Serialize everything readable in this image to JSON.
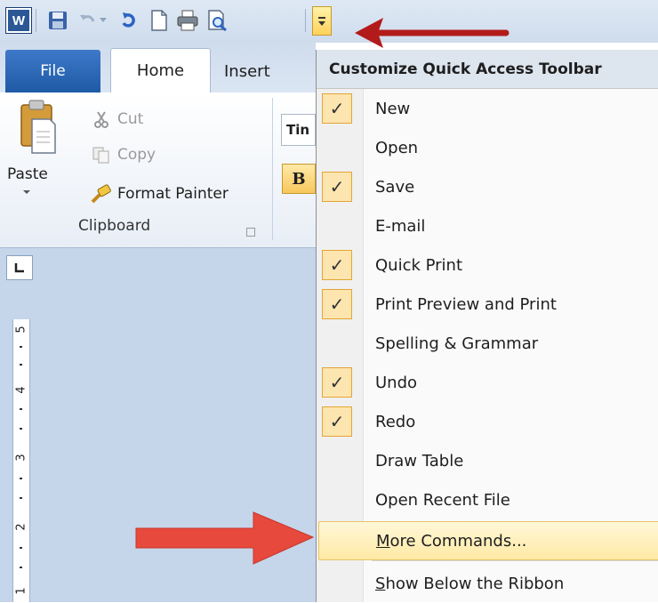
{
  "app": {
    "logo_letter": "W"
  },
  "ribbon": {
    "tabs": {
      "file": "File",
      "home": "Home",
      "insert": "Insert"
    },
    "clipboard": {
      "paste": "Paste",
      "cut": "Cut",
      "copy": "Copy",
      "format_painter": "Format Painter",
      "group_label": "Clipboard"
    },
    "font_box": "Tin",
    "bold": "B"
  },
  "ruler": {
    "numbers": [
      "5",
      "4",
      "3",
      "2",
      "1"
    ]
  },
  "menu": {
    "header": "Customize Quick Access Toolbar",
    "items": [
      {
        "label": "New",
        "checked": true
      },
      {
        "label": "Open",
        "checked": false
      },
      {
        "label": "Save",
        "checked": true
      },
      {
        "label": "E-mail",
        "checked": false
      },
      {
        "label": "Quick Print",
        "checked": true
      },
      {
        "label": "Print Preview and Print",
        "checked": true
      },
      {
        "label": "Spelling & Grammar",
        "checked": false
      },
      {
        "label": "Undo",
        "checked": true
      },
      {
        "label": "Redo",
        "checked": true
      },
      {
        "label": "Draw Table",
        "checked": false
      },
      {
        "label": "Open Recent File",
        "checked": false
      }
    ],
    "more_commands": {
      "first": "M",
      "rest": "ore Commands..."
    },
    "show_below": {
      "first": "S",
      "rest": "how Below the Ribbon"
    },
    "check_glyph": "✓"
  },
  "colors": {
    "annotation_arrow": "#b31b1b",
    "annotation_arrow_bold": "#e8493d",
    "hover_fill": "#ffe9a4",
    "file_tab": "#2b64b3"
  },
  "icons": [
    "word-logo-icon",
    "save-icon",
    "undo-icon",
    "redo-icon",
    "new-doc-icon",
    "quick-print-icon",
    "print-preview-icon",
    "dropdown-icon",
    "paste-icon",
    "cut-icon",
    "copy-icon",
    "format-painter-icon",
    "dialog-launcher-icon",
    "tab-selector-icon",
    "check-icon"
  ]
}
